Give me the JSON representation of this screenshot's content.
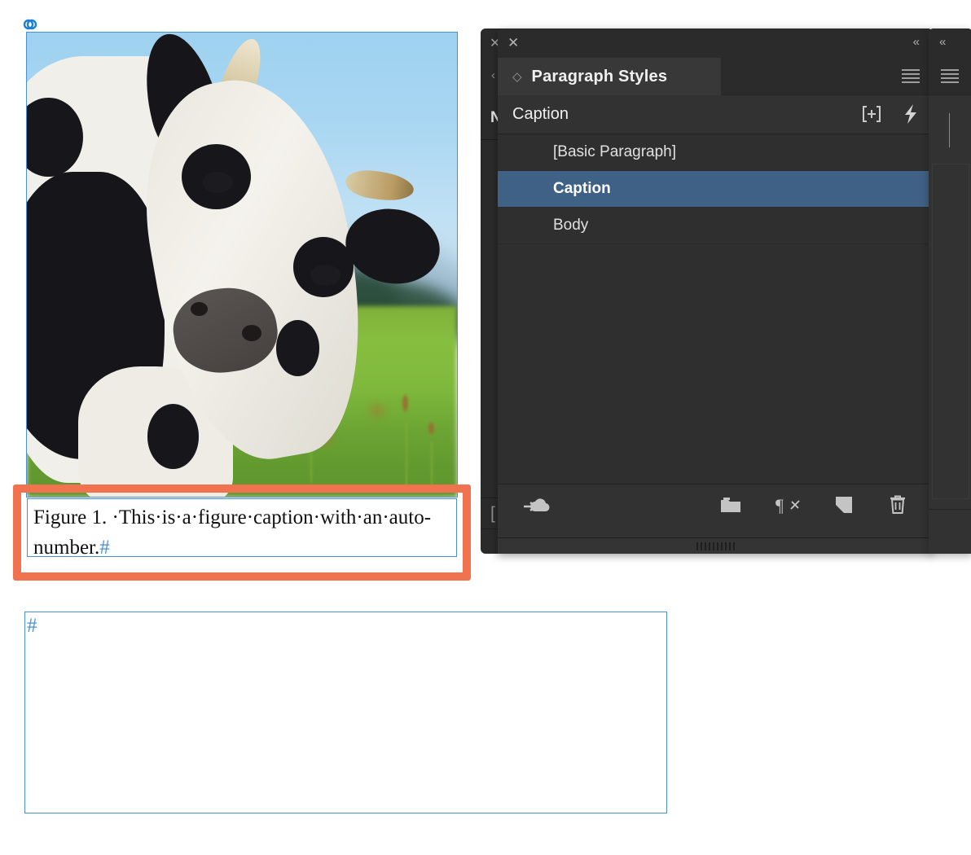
{
  "document": {
    "image_frame": {
      "badge_icon": "link-icon",
      "alt": "photograph of a black and white holstein cow in a green field under blue sky"
    },
    "caption_frame": {
      "prefix": "Figure 1.",
      "separator_dot": "·",
      "words": [
        "This",
        "is",
        "a",
        "figure",
        "caption",
        "with",
        "an",
        "auto-number."
      ],
      "line1": "Figure 1.  ·This·is·a·figure·caption·with·an·",
      "line2": "auto-number.",
      "end_of_story_marker": "#"
    },
    "empty_frame": {
      "end_of_story_marker": "#"
    }
  },
  "hidden_panel": {
    "close_label": "✕",
    "chevron_label": "‹",
    "visible_label": "N",
    "bracket_label": "["
  },
  "panel": {
    "close_label": "✕",
    "collapse_label": "«",
    "tab": {
      "diamond_icon": "diamond-icon",
      "title": "Paragraph Styles"
    },
    "menu_icon": "panel-menu-icon",
    "current_style": {
      "name": "Caption",
      "clear_overrides_label": "[+]",
      "quick_apply_icon": "lightning-bolt-icon"
    },
    "styles": [
      {
        "name": "[Basic Paragraph]",
        "selected": false
      },
      {
        "name": "Caption",
        "selected": true
      },
      {
        "name": "Body",
        "selected": false
      }
    ],
    "footer": {
      "cloud_icon": "cloud-import-icon",
      "new_group_icon": "new-style-group-folder-icon",
      "clear_overrides_icon": "clear-overrides-paragraph-icon",
      "new_style_icon": "new-style-icon",
      "delete_icon": "trash-icon"
    },
    "gripper_icon": "resize-gripper-icon"
  },
  "panel_dock_right": {
    "collapse_label": "«",
    "menu_icon": "panel-menu-icon"
  },
  "annotations": {
    "color": "#f0724f",
    "caption_box_target": "caption text frame",
    "style_row_target": "Caption paragraph style row"
  },
  "colors": {
    "selection_blue": "#3f6186",
    "frame_blue": "#4a90d9",
    "annotation_orange": "#f0724f",
    "panel_bg": "#323232",
    "panel_titlebar": "#2b2b2b"
  }
}
